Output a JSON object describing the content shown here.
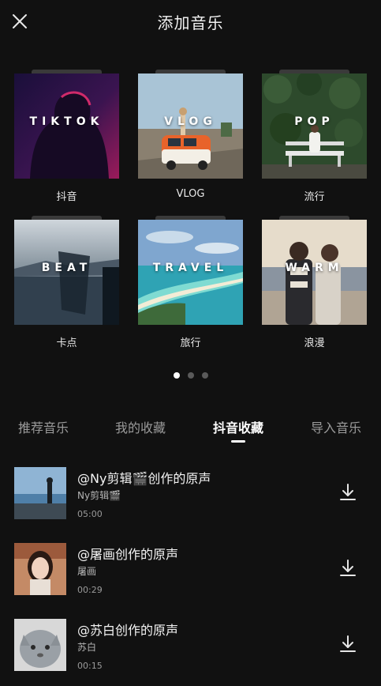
{
  "header": {
    "title": "添加音乐",
    "close_icon": "close-icon"
  },
  "categories": [
    {
      "cover_text": "TIKTOK",
      "label": "抖音"
    },
    {
      "cover_text": "VLOG",
      "label": "VLOG"
    },
    {
      "cover_text": "POP",
      "label": "流行"
    },
    {
      "cover_text": "BEAT",
      "label": "卡点"
    },
    {
      "cover_text": "TRAVEL",
      "label": "旅行"
    },
    {
      "cover_text": "WARM",
      "label": "浪漫"
    }
  ],
  "pagination": {
    "pages": 3,
    "current": 1
  },
  "tabs": [
    {
      "label": "推荐音乐"
    },
    {
      "label": "我的收藏"
    },
    {
      "label": "抖音收藏"
    },
    {
      "label": "导入音乐"
    }
  ],
  "active_tab": 2,
  "songs": [
    {
      "title": "@Ny剪辑🎬创作的原声",
      "artist": "Ny剪辑🎬",
      "duration": "05:00",
      "icon": "download-icon"
    },
    {
      "title": "@屠画创作的原声",
      "artist": "屠画",
      "duration": "00:29",
      "icon": "download-icon"
    },
    {
      "title": "@苏白创作的原声",
      "artist": "苏白",
      "duration": "00:15",
      "icon": "download-icon"
    }
  ],
  "colors": {
    "background": "#111111",
    "text_primary": "#ffffff",
    "text_secondary": "#9a9a9a"
  }
}
